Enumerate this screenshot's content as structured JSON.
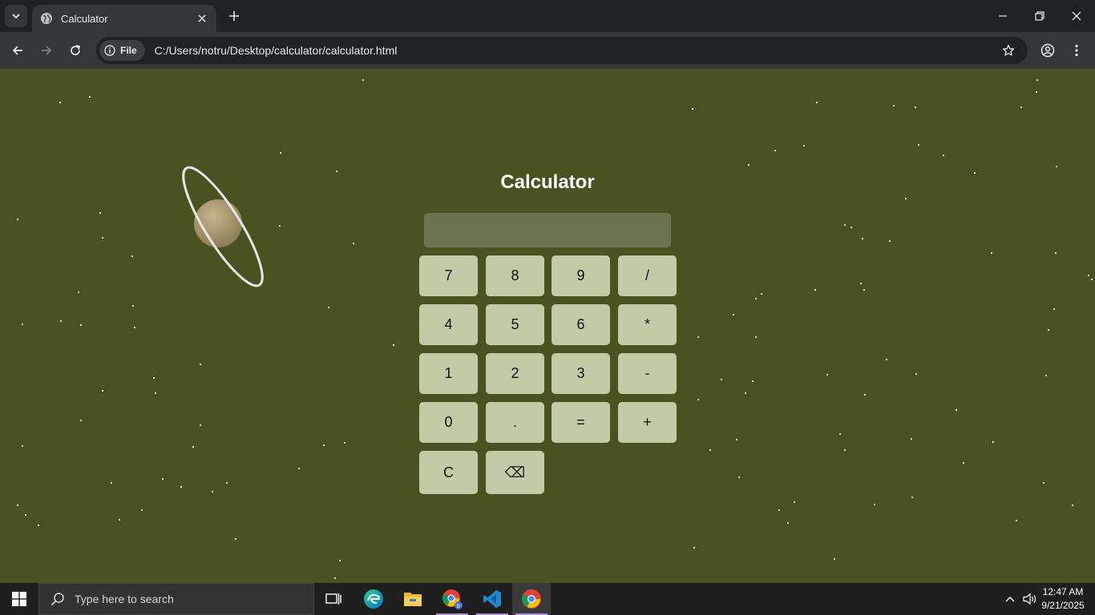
{
  "browser": {
    "tab": {
      "title": "Calculator"
    },
    "address": {
      "chip_label": "File",
      "url": "C:/Users/notru/Desktop/calculator/calculator.html"
    }
  },
  "page": {
    "background": "#4b5221",
    "calculator": {
      "title": "Calculator",
      "display_value": "",
      "button_color": "#c1cba6",
      "display_color": "#6b744e",
      "keys": [
        {
          "label": "7",
          "name": "key-7"
        },
        {
          "label": "8",
          "name": "key-8"
        },
        {
          "label": "9",
          "name": "key-9"
        },
        {
          "label": "/",
          "name": "key-divide"
        },
        {
          "label": "4",
          "name": "key-4"
        },
        {
          "label": "5",
          "name": "key-5"
        },
        {
          "label": "6",
          "name": "key-6"
        },
        {
          "label": "*",
          "name": "key-multiply"
        },
        {
          "label": "1",
          "name": "key-1"
        },
        {
          "label": "2",
          "name": "key-2"
        },
        {
          "label": "3",
          "name": "key-3"
        },
        {
          "label": "-",
          "name": "key-subtract"
        },
        {
          "label": "0",
          "name": "key-0"
        },
        {
          "label": ".",
          "name": "key-decimal"
        },
        {
          "label": "=",
          "name": "key-equals"
        },
        {
          "label": "+",
          "name": "key-add"
        },
        {
          "label": "C",
          "name": "key-clear"
        },
        {
          "label": "⌫",
          "name": "key-backspace"
        }
      ]
    }
  },
  "taskbar": {
    "search_placeholder": "Type here to search",
    "apps": [
      "task-view-icon",
      "edge-icon",
      "file-explorer-icon",
      "chrome-profile-icon",
      "vscode-icon",
      "chrome-icon"
    ],
    "clock": {
      "time": "12:47 AM",
      "date": "9/21/2025"
    }
  }
}
